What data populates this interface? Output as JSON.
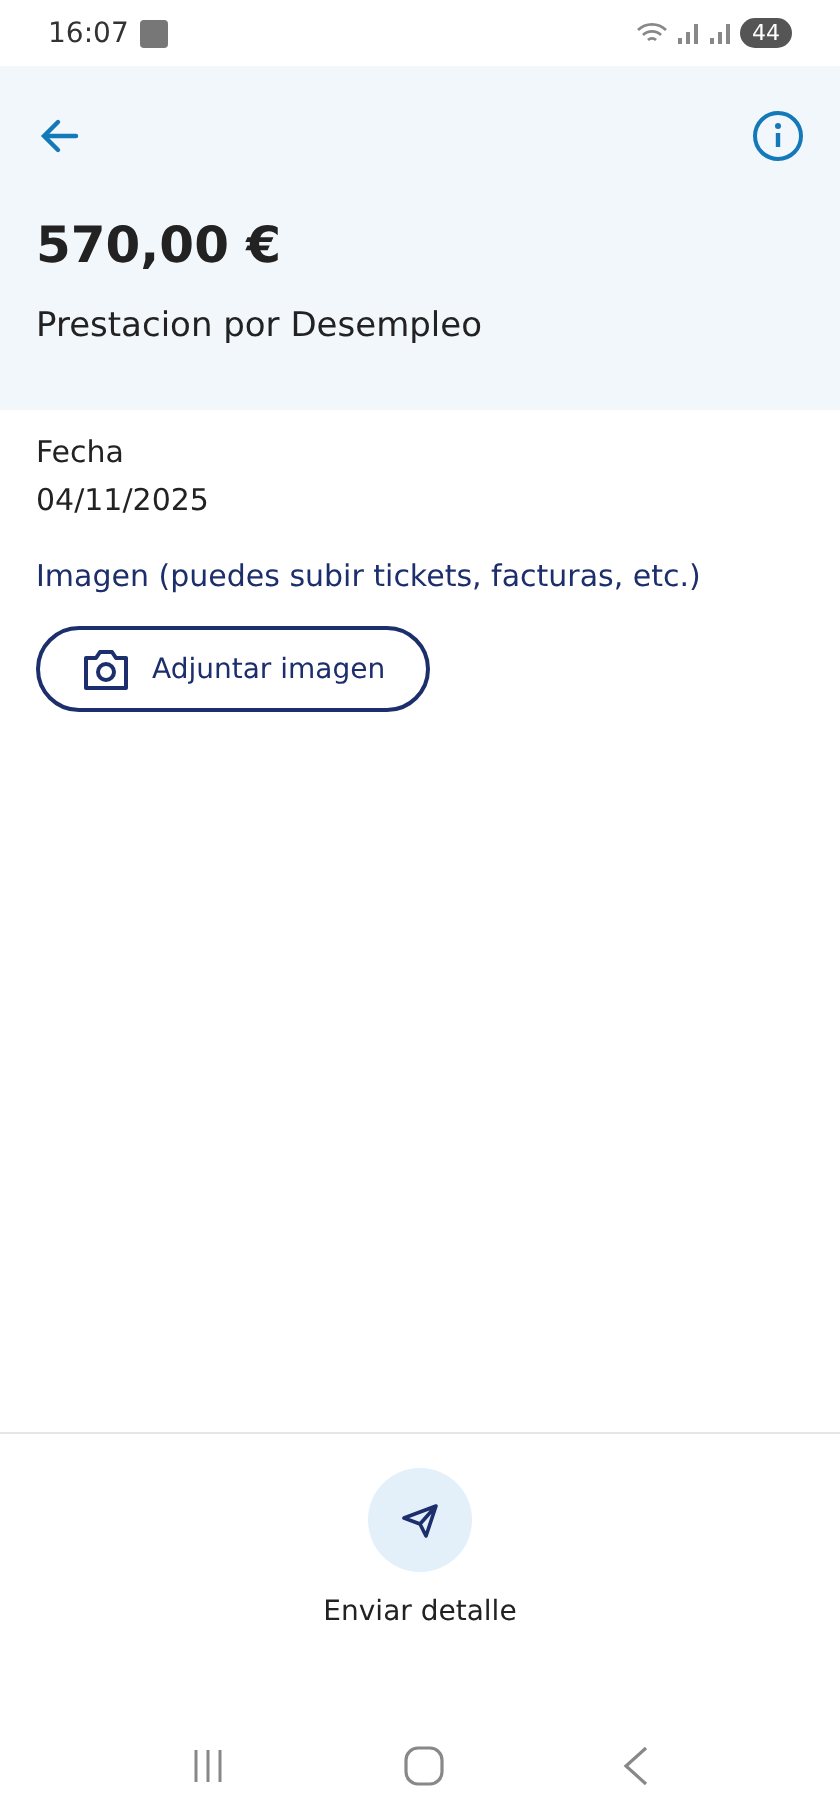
{
  "status_bar": {
    "time": "16:07",
    "battery": "44"
  },
  "header": {
    "amount": "570,00 €",
    "title": "Prestacion por Desempleo"
  },
  "fields": [
    {
      "label": "Fecha",
      "value": "04/11/2025"
    }
  ],
  "image_section": {
    "label": "Imagen (puedes subir tickets, facturas, etc.)",
    "button": "Adjuntar imagen"
  },
  "footer": {
    "action": "Enviar detalle"
  }
}
